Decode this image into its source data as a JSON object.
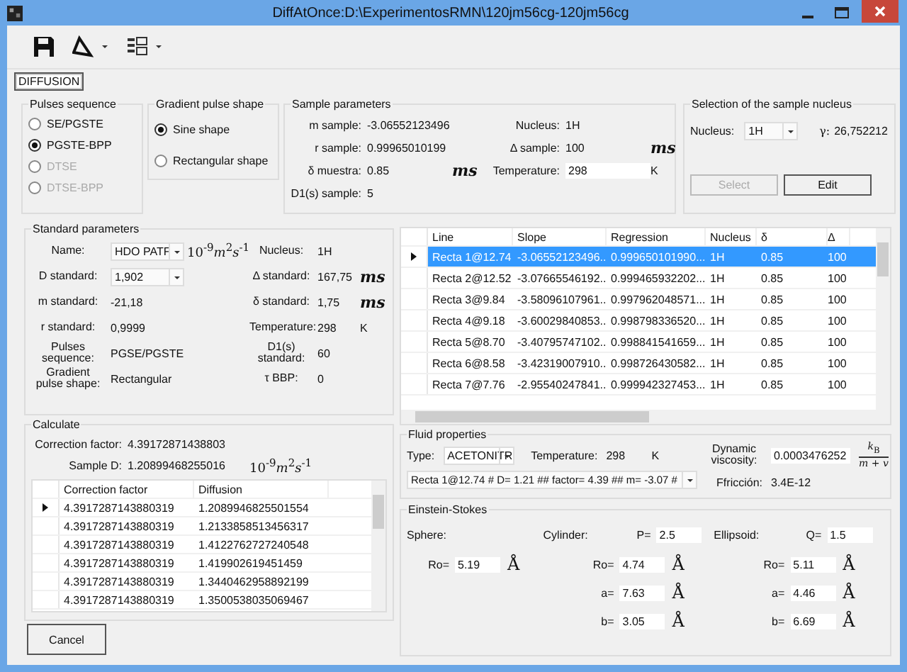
{
  "window": {
    "title": "DiffAtOnce:D:\\ExperimentosRMN\\120jm56cg-120jm56cg"
  },
  "tabs": [
    {
      "label": "DIFFUSION",
      "selected": true
    }
  ],
  "pulses_sequence": {
    "title": "Pulses sequence",
    "options": [
      {
        "label": "SE/PGSTE",
        "selected": false,
        "disabled": false
      },
      {
        "label": "PGSTE-BPP",
        "selected": true,
        "disabled": false
      },
      {
        "label": "DTSE",
        "selected": false,
        "disabled": true
      },
      {
        "label": "DTSE-BPP",
        "selected": false,
        "disabled": true
      }
    ]
  },
  "gradient_pulse_shape": {
    "title": "Gradient pulse shape",
    "options": [
      {
        "label": "Sine shape",
        "selected": true,
        "disabled": false
      },
      {
        "label": "Rectangular shape",
        "selected": false,
        "disabled": false
      }
    ]
  },
  "sample_parameters": {
    "title": "Sample parameters",
    "rows": [
      [
        {
          "label": "m sample:",
          "value": "-3.06552123496",
          "kind": "text"
        },
        {
          "label": "Nucleus:",
          "value": "1H",
          "kind": "text"
        }
      ],
      [
        {
          "label": "r sample:",
          "value": "0.99965010199",
          "kind": "text"
        },
        {
          "label": "Δ sample:",
          "value": "100",
          "kind": "text",
          "unit": {
            "text": "ms",
            "kind": "math"
          }
        }
      ],
      [
        {
          "label": "δ muestra:",
          "value": "0.85",
          "kind": "text",
          "unit": {
            "text": "ms",
            "kind": "math"
          }
        },
        {
          "label": "Temperature:",
          "value": "298",
          "kind": "input",
          "unit": {
            "text": "K",
            "kind": "plain"
          }
        }
      ],
      [
        {
          "label": "D1(s) sample:",
          "value": "5",
          "kind": "text"
        }
      ]
    ]
  },
  "nucleus_selection": {
    "title": "Selection of the sample nucleus",
    "nucleus_label": "Nucleus:",
    "nucleus_value": "1H",
    "gamma_label": "γ:",
    "gamma_value": "26,752212",
    "buttons": [
      {
        "label": "Select",
        "disabled": true
      },
      {
        "label": "Edit",
        "disabled": false
      }
    ]
  },
  "standard_parameters": {
    "title": "Standard parameters",
    "rows": [
      [
        {
          "label": "Name:",
          "value": "HDO PATF",
          "kind": "select",
          "unit": {
            "text": "10$^{-9}$*m*$^{2}$*s*$^{-1}$",
            "kind": "formula"
          }
        },
        {
          "label": "Nucleus:",
          "value": "1H",
          "kind": "text"
        }
      ],
      [
        {
          "label": "D standard:",
          "value": "1,902",
          "kind": "select"
        },
        {
          "label": "Δ standard:",
          "value": "167,75",
          "kind": "text",
          "unit": {
            "text": "ms",
            "kind": "math"
          }
        }
      ],
      [
        {
          "label": "m standard:",
          "value": "-21,18",
          "kind": "text"
        },
        {
          "label": "δ standard:",
          "value": "1,75",
          "kind": "text",
          "unit": {
            "text": "ms",
            "kind": "math"
          }
        }
      ],
      [
        {
          "label": "r standard:",
          "value": "0,9999",
          "kind": "text"
        },
        {
          "label": "Temperature:",
          "value": "298",
          "kind": "text",
          "unit": {
            "text": "K",
            "kind": "plain"
          }
        }
      ],
      [
        {
          "label": "Pulses sequence:",
          "value": "PGSE/PGSTE",
          "kind": "text"
        },
        {
          "label": "D1(s) standard:",
          "value": "60",
          "kind": "text"
        }
      ],
      [
        {
          "label": "Gradient pulse shape:",
          "value": "Rectangular",
          "kind": "text"
        },
        {
          "label": "τ BBP:",
          "value": "0",
          "kind": "text"
        }
      ]
    ]
  },
  "lines_table": {
    "columns": [
      "Line",
      "Slope",
      "Regression",
      "Nucleus",
      "δ",
      "Δ"
    ],
    "rows": [
      {
        "current": true,
        "selected": true,
        "cells": [
          "Recta 1@12.74",
          "-3.06552123496...",
          "0.999650101990...",
          "1H",
          "0.85",
          "100"
        ]
      },
      {
        "current": false,
        "selected": false,
        "cells": [
          "Recta 2@12.52",
          "-3.07665546192...",
          "0.999465932202...",
          "1H",
          "0.85",
          "100"
        ]
      },
      {
        "current": false,
        "selected": false,
        "cells": [
          "Recta 3@9.84",
          "-3.58096107961...",
          "0.997962048571...",
          "1H",
          "0.85",
          "100"
        ]
      },
      {
        "current": false,
        "selected": false,
        "cells": [
          "Recta 4@9.18",
          "-3.60029840853...",
          "0.998798336520...",
          "1H",
          "0.85",
          "100"
        ]
      },
      {
        "current": false,
        "selected": false,
        "cells": [
          "Recta 5@8.70",
          "-3.40795747102...",
          "0.998841541659...",
          "1H",
          "0.85",
          "100"
        ]
      },
      {
        "current": false,
        "selected": false,
        "cells": [
          "Recta 6@8.58",
          "-3.42319007910...",
          "0.998726430582...",
          "1H",
          "0.85",
          "100"
        ]
      },
      {
        "current": false,
        "selected": false,
        "cells": [
          "Recta 7@7.76",
          "-2.95540247841...",
          "0.999942327453...",
          "1H",
          "0.85",
          "100"
        ]
      }
    ]
  },
  "calculate": {
    "title": "Calculate",
    "correction_label": "Correction factor:",
    "correction_value": "4.39172871438803",
    "sample_d_label": "Sample D:",
    "sample_d_value": "1.20899468255016",
    "sample_d_unit": "10$^{-9}$*m*$^{2}$*s*$^{-1}$",
    "table": {
      "columns": [
        "Correction factor",
        "Diffusion"
      ],
      "rows": [
        {
          "current": true,
          "cells": [
            "4.3917287143880319",
            "1.2089946825501554"
          ]
        },
        {
          "current": false,
          "cells": [
            "4.3917287143880319",
            "1.2133858513456317"
          ]
        },
        {
          "current": false,
          "cells": [
            "4.3917287143880319",
            "1.4122762727240548"
          ]
        },
        {
          "current": false,
          "cells": [
            "4.3917287143880319",
            "1.419902619451459"
          ]
        },
        {
          "current": false,
          "cells": [
            "4.3917287143880319",
            "1.3440462958892199"
          ]
        },
        {
          "current": false,
          "cells": [
            "4.3917287143880319",
            "1.3500538035069467"
          ]
        }
      ]
    }
  },
  "cancel_button": "Cancel",
  "fluid_properties": {
    "title": "Fluid properties",
    "type_label": "Type:",
    "type_value": "ACETONITR",
    "temperature_label": "Temperature:",
    "temperature_value": "298",
    "temperature_unit": "K",
    "viscosity_label": "Dynamic viscosity:",
    "viscosity_value": "0.0003476252",
    "formula_numerator": "*k*$_{B}$",
    "formula_denominator": "*m* + *v*",
    "line_select": "Recta 1@12.74  #  D= 1.21  ##  factor= 4.39  ##  m= -3.07  #",
    "friction_label": "Ffricción:",
    "friction_value": "3.4E-12"
  },
  "einstein_stokes": {
    "title": "Einstein-Stokes",
    "shapes": [
      {
        "name": "Sphere:",
        "params": [
          {
            "label": "Ro=",
            "value": "5.19",
            "unit": "Å"
          }
        ]
      },
      {
        "name": "Cylinder:",
        "factor": {
          "label": "P=",
          "value": "2.5"
        },
        "params": [
          {
            "label": "Ro=",
            "value": "4.74",
            "unit": "Å"
          },
          {
            "label": "a=",
            "value": "7.63",
            "unit": "Å"
          },
          {
            "label": "b=",
            "value": "3.05",
            "unit": "Å"
          }
        ]
      },
      {
        "name": "Ellipsoid:",
        "factor": {
          "label": "Q=",
          "value": "1.5"
        },
        "params": [
          {
            "label": "Ro=",
            "value": "5.11",
            "unit": "Å"
          },
          {
            "label": "a=",
            "value": "4.46",
            "unit": "Å"
          },
          {
            "label": "b=",
            "value": "6.69",
            "unit": "Å"
          }
        ]
      }
    ]
  }
}
